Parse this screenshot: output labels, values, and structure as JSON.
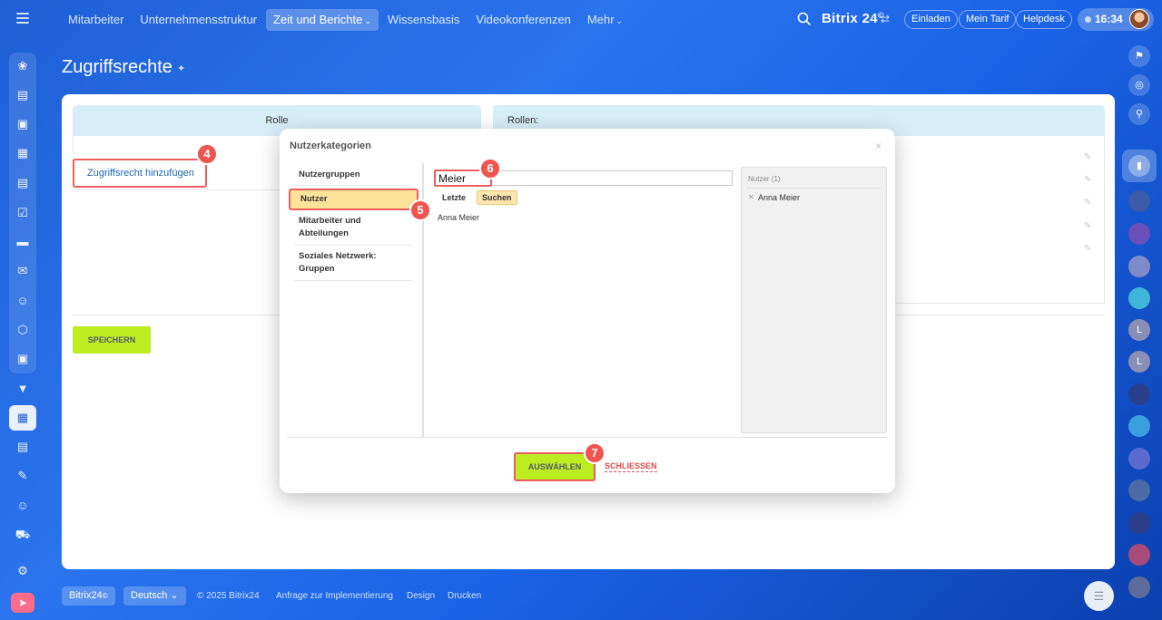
{
  "topbar": {
    "nav": [
      "Mitarbeiter",
      "Unternehmensstruktur",
      "Zeit und Berichte",
      "Wissensbasis",
      "Videokonferenzen",
      "Mehr"
    ],
    "active_nav": "Zeit und Berichte",
    "brand": "Bitrix 24",
    "brand_mark": "©",
    "invite": "Einladen",
    "tariff": "Mein Tarif",
    "helpdesk": "Helpdesk",
    "time": "16:34"
  },
  "page": {
    "title": "Zugriffsrechte"
  },
  "table": {
    "col_role": "Rolle",
    "col_roles": "Rollen:",
    "add_access": "Zugriffsrecht hinzufügen",
    "save": "SPEICHERN"
  },
  "dialog": {
    "title": "Nutzerkategorien",
    "close_symbol": "×",
    "tabs": [
      "Nutzergruppen",
      "Nutzer",
      "Mitarbeiter und Abteilungen",
      "Soziales Netzwerk: Gruppen"
    ],
    "active_tab": "Nutzer",
    "search_value": "Meier",
    "subtabs": [
      "Letzte",
      "Suchen"
    ],
    "results": [
      "Anna Meier"
    ],
    "selected_header": "Nutzer (1)",
    "selected": [
      "Anna Meier"
    ],
    "select_button": "AUSWÄHLEN",
    "close_button": "SCHLIESSEN"
  },
  "badges": [
    "4",
    "5",
    "6",
    "7"
  ],
  "footer": {
    "brand": "Bitrix24",
    "brand_mark": "©",
    "language": "Deutsch",
    "copyright": "© 2025 Bitrix24",
    "links": [
      "Anfrage zur Implementierung",
      "Design",
      "Drucken"
    ]
  },
  "colors": {
    "accent_green": "#bbed21",
    "highlight_red": "#ee5c5c",
    "header_blue": "#d7eef9"
  },
  "left_icons": [
    "puzzle-icon",
    "news-icon",
    "chat-icon",
    "calendar-icon",
    "document-icon",
    "task-icon",
    "crm-icon",
    "mail-icon",
    "users-icon",
    "shield-icon",
    "presentation-icon",
    "funnel-icon",
    "time-reports-icon",
    "store-icon",
    "sign-icon",
    "robot-icon",
    "cart-icon",
    "settings-icon",
    "rocket-icon"
  ],
  "right_avatars": [
    "L",
    "L"
  ]
}
